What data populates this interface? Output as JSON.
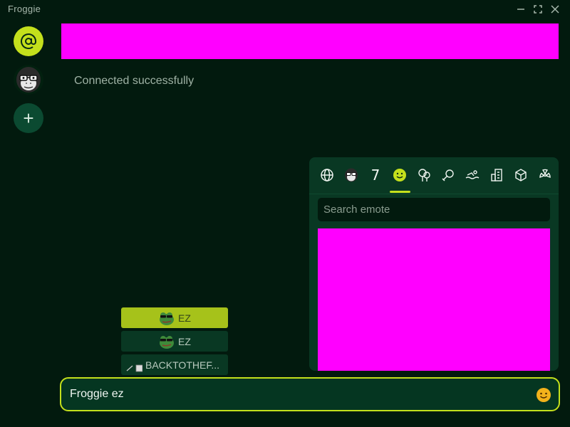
{
  "window": {
    "title": "Froggie"
  },
  "sidebar": {
    "items": [
      {
        "name": "mentions",
        "icon": "at-sign-icon"
      },
      {
        "name": "server",
        "icon": "gorilla-avatar-icon"
      },
      {
        "name": "add-server",
        "icon": "plus-icon",
        "label": "+"
      }
    ]
  },
  "main": {
    "status": "Connected successfully"
  },
  "emote_picker": {
    "tabs": [
      {
        "name": "global",
        "icon": "globe-icon"
      },
      {
        "name": "channel",
        "icon": "gorilla-icon"
      },
      {
        "name": "7tv",
        "icon": "7tv-icon",
        "label": "7"
      },
      {
        "name": "smileys",
        "icon": "smiley-icon",
        "active": true
      },
      {
        "name": "nature",
        "icon": "tree-icon"
      },
      {
        "name": "food",
        "icon": "food-icon"
      },
      {
        "name": "activities",
        "icon": "swimmer-icon"
      },
      {
        "name": "travel",
        "icon": "building-icon"
      },
      {
        "name": "objects",
        "icon": "cube-icon"
      },
      {
        "name": "symbols",
        "icon": "radiation-icon"
      }
    ],
    "search_placeholder": "Search emote"
  },
  "suggestions": [
    {
      "label": "EZ",
      "icon": "pepe-sunglasses-icon",
      "selected": true
    },
    {
      "label": "EZ",
      "icon": "pepe-sunglasses-icon",
      "selected": false
    },
    {
      "label": "BACKTOTHEF...",
      "icon": "backtothefuture-emote-icon",
      "selected": false
    }
  ],
  "chat_input": {
    "value": "Froggie ez"
  },
  "colors": {
    "accent": "#c4e01c",
    "background": "#021a0e",
    "panel": "#093823",
    "placeholder_image": "#ff00ff"
  }
}
